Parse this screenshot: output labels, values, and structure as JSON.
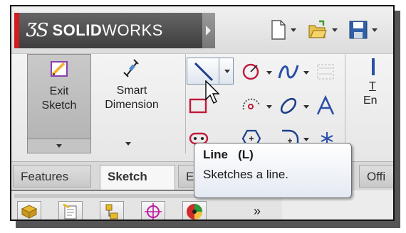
{
  "app": {
    "brand_mark": "ƷS",
    "brand_name_bold": "SOLID",
    "brand_name_rest": "WORKS",
    "brand_color": "#d01e1e"
  },
  "titlebar_icons": [
    {
      "name": "new-document-icon"
    },
    {
      "name": "open-folder-icon"
    },
    {
      "name": "save-icon"
    }
  ],
  "command_manager": {
    "exit_sketch": {
      "line1": "Exit",
      "line2": "Sketch"
    },
    "smart_dimension": {
      "line1": "Smart",
      "line2": "Dimension"
    },
    "partial_label": {
      "line1": "T",
      "line2": "En"
    },
    "sketch_tools": [
      "line-icon",
      "circle-icon",
      "spline-icon",
      "trim-icon",
      "rectangle-icon",
      "arc-icon",
      "ellipse-icon",
      "text-icon",
      "slot-icon",
      "polygon-icon",
      "fillet-icon",
      "point-icon"
    ]
  },
  "tabs": [
    {
      "label": "Features",
      "active": false
    },
    {
      "label": "Sketch",
      "active": true
    },
    {
      "label": "E",
      "active": false
    },
    {
      "label": "Offi",
      "active": false
    }
  ],
  "panel": {
    "more_label": "»"
  },
  "tooltip": {
    "title": "Line   (L)",
    "description": "Sketches a line."
  }
}
